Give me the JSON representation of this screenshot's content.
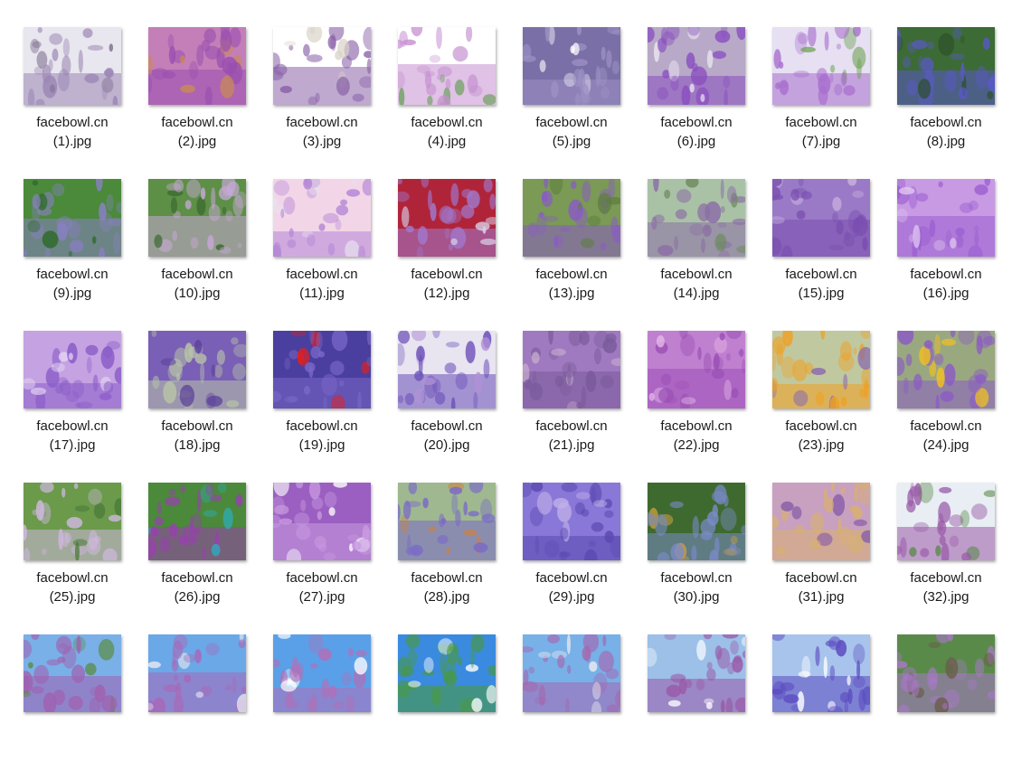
{
  "files": [
    {
      "line1": "facebowl.cn",
      "line2": "(1).jpg",
      "colors": [
        "#e8e6ee",
        "#9b86b4",
        "#6b5a7e"
      ],
      "icon": "lavender-bundle-photo"
    },
    {
      "line1": "facebowl.cn",
      "line2": "(2).jpg",
      "colors": [
        "#c47fb8",
        "#9a4fb0",
        "#c98a55"
      ],
      "icon": "lavender-basket-photo"
    },
    {
      "line1": "facebowl.cn",
      "line2": "(3).jpg",
      "colors": [
        "#ffffff",
        "#8a62a8",
        "#d9d2c6"
      ],
      "icon": "lavender-sprigs-photo"
    },
    {
      "line1": "facebowl.cn",
      "line2": "(4).jpg",
      "colors": [
        "#ffffff",
        "#c58fd0",
        "#6aa05a"
      ],
      "icon": "lilac-bouquet-photo"
    },
    {
      "line1": "facebowl.cn",
      "line2": "(5).jpg",
      "colors": [
        "#7a6fa6",
        "#9d90c4",
        "#ffffff"
      ],
      "icon": "lavender-heart-photo"
    },
    {
      "line1": "facebowl.cn",
      "line2": "(6).jpg",
      "colors": [
        "#b7a9c7",
        "#8a4fc0",
        "#f3eef6"
      ],
      "icon": "lilac-wood-photo"
    },
    {
      "line1": "facebowl.cn",
      "line2": "(7).jpg",
      "colors": [
        "#e6e0f2",
        "#a86fce",
        "#6aa04d"
      ],
      "icon": "lilac-branch-photo"
    },
    {
      "line1": "facebowl.cn",
      "line2": "(8).jpg",
      "colors": [
        "#3c6b35",
        "#5a58c8",
        "#2c4f2a"
      ],
      "icon": "salvia-flowers-photo"
    },
    {
      "line1": "facebowl.cn",
      "line2": "(9).jpg",
      "colors": [
        "#4a8a3a",
        "#8a7fc4",
        "#2e6a2a"
      ],
      "icon": "hyacinth-leaves-photo"
    },
    {
      "line1": "facebowl.cn",
      "line2": "(10).jpg",
      "colors": [
        "#5d8f46",
        "#c7a8d6",
        "#3c6b30"
      ],
      "icon": "lavender-field-photo"
    },
    {
      "line1": "facebowl.cn",
      "line2": "(11).jpg",
      "colors": [
        "#f2d6e8",
        "#b486d6",
        "#e8e0f0"
      ],
      "icon": "lavender-soft-photo"
    },
    {
      "line1": "facebowl.cn",
      "line2": "(12).jpg",
      "colors": [
        "#b0243a",
        "#a07ad0",
        "#d8d0e8"
      ],
      "icon": "lavender-red-bokeh-photo"
    },
    {
      "line1": "facebowl.cn",
      "line2": "(13).jpg",
      "colors": [
        "#7a9a55",
        "#8a5cc4",
        "#5e7e3e"
      ],
      "icon": "lavender-bee-photo"
    },
    {
      "line1": "facebowl.cn",
      "line2": "(14).jpg",
      "colors": [
        "#a9c2a6",
        "#8c6fa6",
        "#6e8c5e"
      ],
      "icon": "lavender-rows-photo"
    },
    {
      "line1": "facebowl.cn",
      "line2": "(15).jpg",
      "colors": [
        "#9a7ac6",
        "#7a4fb0",
        "#c9b0e0"
      ],
      "icon": "lavender-bush-photo"
    },
    {
      "line1": "facebowl.cn",
      "line2": "(16).jpg",
      "colors": [
        "#c89ae4",
        "#9b5fd0",
        "#e0c8f0"
      ],
      "icon": "lavender-purple-photo"
    },
    {
      "line1": "facebowl.cn",
      "line2": "(17).jpg",
      "colors": [
        "#c5a2e2",
        "#8a5cc8",
        "#e6d6f4"
      ],
      "icon": "lavender-light-photo"
    },
    {
      "line1": "facebowl.cn",
      "line2": "(18).jpg",
      "colors": [
        "#7a5fb6",
        "#b8c4a8",
        "#5a3f9a"
      ],
      "icon": "lavender-mixed-photo"
    },
    {
      "line1": "facebowl.cn",
      "line2": "(19).jpg",
      "colors": [
        "#4a3f9e",
        "#7a68c8",
        "#e02020"
      ],
      "icon": "lavender-poppy-photo"
    },
    {
      "line1": "facebowl.cn",
      "line2": "(20).jpg",
      "colors": [
        "#e8e4f0",
        "#6a4fb8",
        "#b090d6"
      ],
      "icon": "lavender-sky-photo"
    },
    {
      "line1": "facebowl.cn",
      "line2": "(21).jpg",
      "colors": [
        "#a07ac0",
        "#7a5a9a",
        "#c8b0d0"
      ],
      "icon": "lavender-bundle-field-photo"
    },
    {
      "line1": "facebowl.cn",
      "line2": "(22).jpg",
      "colors": [
        "#c080d0",
        "#9a4fb6",
        "#e4b8e8"
      ],
      "icon": "lilac-pink-photo"
    },
    {
      "line1": "facebowl.cn",
      "line2": "(23).jpg",
      "colors": [
        "#c0c8a0",
        "#f0a020",
        "#8a6ab0"
      ],
      "icon": "orange-flower-photo"
    },
    {
      "line1": "facebowl.cn",
      "line2": "(24).jpg",
      "colors": [
        "#9aa880",
        "#8a5cc4",
        "#f0c020"
      ],
      "icon": "yellow-butterfly-photo"
    },
    {
      "line1": "facebowl.cn",
      "line2": "(25).jpg",
      "colors": [
        "#6a9a4a",
        "#d0b8e0",
        "#4a7a3a"
      ],
      "icon": "lavender-white-photo"
    },
    {
      "line1": "facebowl.cn",
      "line2": "(26).jpg",
      "colors": [
        "#4a8a3a",
        "#9a3fb0",
        "#2ab0c0"
      ],
      "icon": "blue-butterfly-photo"
    },
    {
      "line1": "facebowl.cn",
      "line2": "(27).jpg",
      "colors": [
        "#9a5fc0",
        "#c89ae0",
        "#ffffff"
      ],
      "icon": "swallowtail-photo"
    },
    {
      "line1": "facebowl.cn",
      "line2": "(28).jpg",
      "colors": [
        "#9fb890",
        "#7a6ac8",
        "#d0803a"
      ],
      "icon": "painted-lady-photo"
    },
    {
      "line1": "facebowl.cn",
      "line2": "(29).jpg",
      "colors": [
        "#8a78d8",
        "#5a48b0",
        "#c0b0e8"
      ],
      "icon": "bee-lavender-photo"
    },
    {
      "line1": "facebowl.cn",
      "line2": "(30).jpg",
      "colors": [
        "#3e6a30",
        "#7a8ac8",
        "#d0a040"
      ],
      "icon": "bee-wisteria-photo"
    },
    {
      "line1": "facebowl.cn",
      "line2": "(31).jpg",
      "colors": [
        "#c8a0c0",
        "#d8b070",
        "#8a60a8"
      ],
      "icon": "lavender-basket-field-photo"
    },
    {
      "line1": "facebowl.cn",
      "line2": "(32).jpg",
      "colors": [
        "#e8eef4",
        "#9a5aa8",
        "#5a8a4a"
      ],
      "icon": "lavender-path-photo"
    },
    {
      "line1": "",
      "line2": "",
      "colors": [
        "#7ab0e8",
        "#a060b0",
        "#5a8a3a"
      ],
      "icon": "treble-clef-sculpture-photo"
    },
    {
      "line1": "",
      "line2": "",
      "colors": [
        "#6aa8e8",
        "#a868b8",
        "#e8e8f0"
      ],
      "icon": "love-letters-photo"
    },
    {
      "line1": "",
      "line2": "",
      "colors": [
        "#5aa0e8",
        "#b070b8",
        "#ffffff"
      ],
      "icon": "white-sculpture-photo"
    },
    {
      "line1": "",
      "line2": "",
      "colors": [
        "#3a8ae0",
        "#4a9a3a",
        "#ffffff"
      ],
      "icon": "green-path-photo"
    },
    {
      "line1": "",
      "line2": "",
      "colors": [
        "#78b0e8",
        "#a468b0",
        "#f0f0f0"
      ],
      "icon": "tower-field-photo"
    },
    {
      "line1": "",
      "line2": "",
      "colors": [
        "#9cc0e8",
        "#9a58a8",
        "#ffffff"
      ],
      "icon": "windmill-field-photo"
    },
    {
      "line1": "",
      "line2": "",
      "colors": [
        "#a8c4ec",
        "#5a4ac0",
        "#ffffff"
      ],
      "icon": "pavilion-field-photo"
    },
    {
      "line1": "",
      "line2": "",
      "colors": [
        "#5a8a4a",
        "#a878c8",
        "#6a5a4a"
      ],
      "icon": "pergola-field-photo"
    }
  ]
}
